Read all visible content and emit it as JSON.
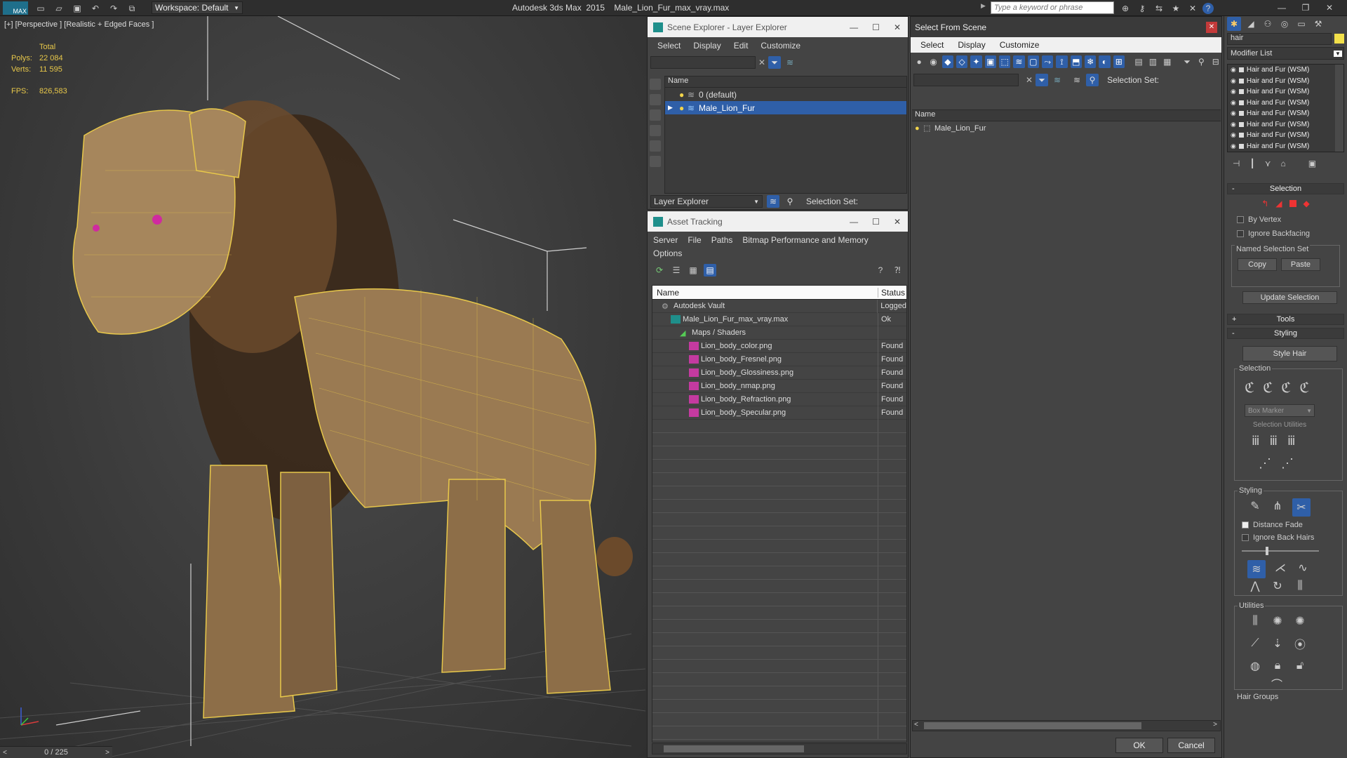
{
  "app": {
    "title": "Autodesk 3ds Max  2015    Male_Lion_Fur_max_vray.max",
    "workspace": "Workspace: Default",
    "search_placeholder": "Type a keyword or phrase"
  },
  "viewport": {
    "label": "[+] [Perspective ] [Realistic + Edged Faces ]",
    "stats": {
      "total_label": "Total",
      "polys_label": "Polys:",
      "polys_value": "22 084",
      "verts_label": "Verts:",
      "verts_value": "11 595",
      "fps_label": "FPS:",
      "fps_value": "826,583"
    },
    "timeline": "0 / 225"
  },
  "scene_explorer": {
    "title": "Scene Explorer - Layer Explorer",
    "menu": [
      "Select",
      "Display",
      "Edit",
      "Customize"
    ],
    "column_name": "Name",
    "layers": [
      {
        "name": "0 (default)",
        "selected": false
      },
      {
        "name": "Male_Lion_Fur",
        "selected": true
      }
    ],
    "footer_dropdown": "Layer Explorer",
    "selection_set_label": "Selection Set:"
  },
  "asset_tracking": {
    "title": "Asset Tracking",
    "menu": [
      "Server",
      "File",
      "Paths",
      "Bitmap Performance and Memory"
    ],
    "menu2": "Options",
    "col_name": "Name",
    "col_status": "Status",
    "rows": [
      {
        "name": "Autodesk Vault",
        "status": "Logged",
        "indent": 1
      },
      {
        "name": "Male_Lion_Fur_max_vray.max",
        "status": "Ok",
        "indent": 2
      },
      {
        "name": "Maps / Shaders",
        "status": "",
        "indent": 3
      },
      {
        "name": "Lion_body_color.png",
        "status": "Found",
        "indent": 4
      },
      {
        "name": "Lion_body_Fresnel.png",
        "status": "Found",
        "indent": 4
      },
      {
        "name": "Lion_body_Glossiness.png",
        "status": "Found",
        "indent": 4
      },
      {
        "name": "Lion_body_nmap.png",
        "status": "Found",
        "indent": 4
      },
      {
        "name": "Lion_body_Refraction.png",
        "status": "Found",
        "indent": 4
      },
      {
        "name": "Lion_body_Specular.png",
        "status": "Found",
        "indent": 4
      }
    ]
  },
  "select_from_scene": {
    "title": "Select From Scene",
    "menu": [
      "Select",
      "Display",
      "Customize"
    ],
    "selection_set_label": "Selection Set:",
    "column_name": "Name",
    "items": [
      "Male_Lion_Fur"
    ],
    "ok_label": "OK",
    "cancel_label": "Cancel"
  },
  "command_panel": {
    "object_name": "hair",
    "modifier_list": "Modifier List",
    "stack": [
      "Hair and Fur (WSM)",
      "Hair and Fur (WSM)",
      "Hair and Fur (WSM)",
      "Hair and Fur (WSM)",
      "Hair and Fur (WSM)",
      "Hair and Fur (WSM)",
      "Hair and Fur (WSM)",
      "Hair and Fur (WSM)"
    ],
    "selection_title": "Selection",
    "by_vertex": "By Vertex",
    "ignore_backfacing": "Ignore Backfacing",
    "named_selection_set": "Named Selection Set",
    "copy": "Copy",
    "paste": "Paste",
    "update_selection": "Update Selection",
    "tools_title": "Tools",
    "styling_title": "Styling",
    "style_hair": "Style Hair",
    "sel_group": "Selection",
    "box_marker": "Box Marker",
    "selection_utilities": "Selection Utilities",
    "styling_group": "Styling",
    "distance_fade": "Distance Fade",
    "ignore_back_hairs": "Ignore Back Hairs",
    "utilities_group": "Utilities",
    "hair_groups": "Hair Groups"
  },
  "colors": {
    "accent_blue": "#2f5fa8",
    "wire_yellow": "#e8c84a"
  }
}
